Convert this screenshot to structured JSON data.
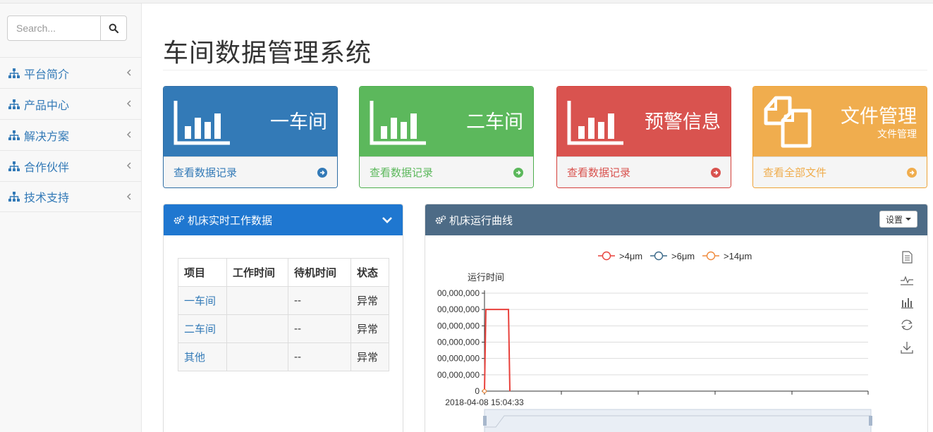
{
  "app": {
    "title": "车间数据管理系统"
  },
  "search": {
    "placeholder": "Search..."
  },
  "sidebar": {
    "items": [
      {
        "label": "平台简介"
      },
      {
        "label": "产品中心"
      },
      {
        "label": "解决方案"
      },
      {
        "label": "合作伙伴"
      },
      {
        "label": "技术支持"
      }
    ]
  },
  "cards": [
    {
      "title": "一车间",
      "subtitle": "",
      "link": "查看数据记录",
      "color": "#337ab7",
      "icon": "bar-chart-icon"
    },
    {
      "title": "二车间",
      "subtitle": "",
      "link": "查看数据记录",
      "color": "#5cb85c",
      "icon": "bar-chart-icon"
    },
    {
      "title": "预警信息",
      "subtitle": "",
      "link": "查看数据记录",
      "color": "#d9534f",
      "icon": "bar-chart-icon"
    },
    {
      "title": "文件管理",
      "subtitle": "文件管理",
      "link": "查看全部文件",
      "color": "#f0ad4e",
      "icon": "files-icon"
    }
  ],
  "left_panel": {
    "title": "机床实时工作数据",
    "table": {
      "headers": [
        "项目",
        "工作时间",
        "待机时间",
        "状态"
      ],
      "rows": [
        [
          "一车间",
          "",
          "--",
          "异常"
        ],
        [
          "二车间",
          "",
          "--",
          "异常"
        ],
        [
          "其他",
          "",
          "--",
          "异常"
        ]
      ]
    }
  },
  "right_panel": {
    "title": "机床运行曲线",
    "settings_label": "设置"
  },
  "chart_data": {
    "type": "line",
    "ylabel": "运行时间",
    "y_tick_labels": [
      "0",
      "00,000,000",
      "00,000,000",
      "00,000,000",
      "00,000,000",
      "00,000,000",
      "00,000,000"
    ],
    "x_tick_labels": [
      "2018-04-08 15:04:33"
    ],
    "legend": [
      {
        "name": ">4μm",
        "color": "#e8413c"
      },
      {
        "name": ">6μm",
        "color": "#3c6a8a"
      },
      {
        "name": ">14μm",
        "color": "#f08a3c"
      }
    ],
    "legend_position": "top-center",
    "grid": true,
    "series": [
      {
        "name": ">4μm",
        "values": [
          0,
          5,
          5,
          0
        ]
      }
    ],
    "ylim": [
      0,
      6
    ],
    "has_datazoom": true
  }
}
